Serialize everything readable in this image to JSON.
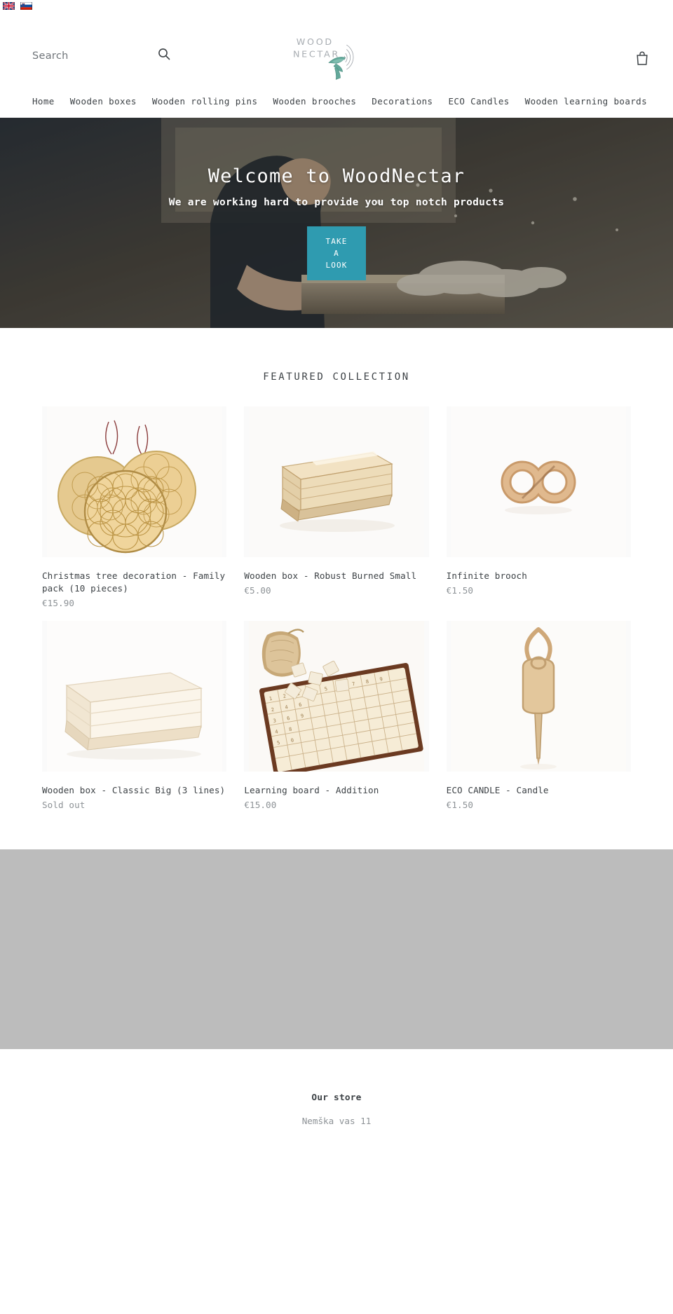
{
  "langbar": {
    "flags": [
      {
        "name": "english-flag",
        "alt": "English"
      },
      {
        "name": "slovenian-flag",
        "alt": "Slovenščina"
      }
    ]
  },
  "header": {
    "search": {
      "placeholder": "Search",
      "value": "",
      "button_label": "Search"
    },
    "logo": {
      "line1": "WOOD",
      "line2": "NECTAR",
      "alt": "WoodNectar"
    },
    "cart": {
      "label": "Cart"
    }
  },
  "nav": {
    "items": [
      {
        "label": "Home"
      },
      {
        "label": "Wooden boxes"
      },
      {
        "label": "Wooden rolling pins"
      },
      {
        "label": "Wooden brooches"
      },
      {
        "label": "Decorations"
      },
      {
        "label": "ECO Candles"
      },
      {
        "label": "Wooden learning boards"
      }
    ]
  },
  "hero": {
    "title": "Welcome to WoodNectar",
    "subtitle": "We are working hard to provide you top notch products",
    "button_label": "TAKE A LOOK",
    "button_color": "#2f9bb0"
  },
  "featured": {
    "heading": "FEATURED COLLECTION",
    "products": [
      {
        "title": "Christmas tree decoration - Family pack (10 pieces)",
        "price": "€15.90",
        "image": "ornament-discs"
      },
      {
        "title": "Wooden box - Robust Burned Small",
        "price": "€5.00",
        "image": "burned-crate"
      },
      {
        "title": "Infinite brooch",
        "price": "€1.50",
        "image": "infinity-brooch"
      },
      {
        "title": "Wooden box - Classic Big (3 lines)",
        "price": "Sold out",
        "image": "classic-crate"
      },
      {
        "title": "Learning board - Addition",
        "price": "€15.00",
        "image": "learning-board"
      },
      {
        "title": "ECO CANDLE - Candle",
        "price": "€1.50",
        "image": "eco-candle"
      }
    ]
  },
  "footer": {
    "heading": "Our store",
    "address": "Nemška vas 11"
  }
}
